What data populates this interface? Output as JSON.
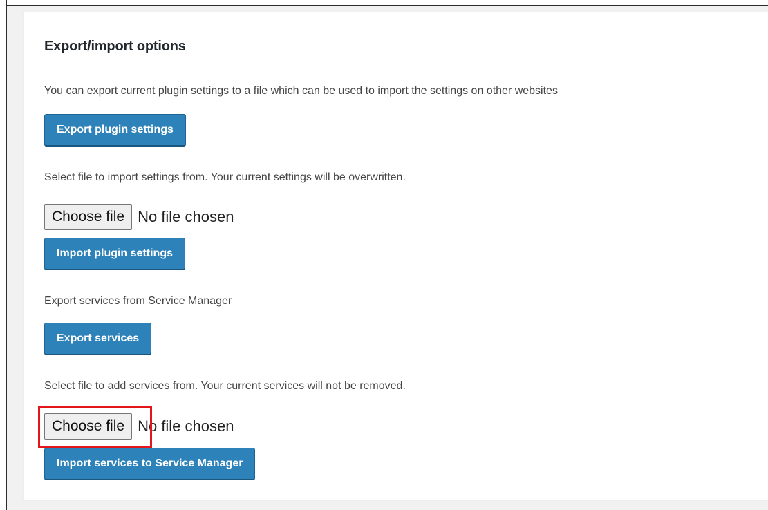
{
  "section": {
    "title": "Export/import options"
  },
  "export_settings": {
    "description": "You can export current plugin settings to a file which can be used to import the settings on other websites",
    "button_label": "Export plugin settings"
  },
  "import_settings": {
    "description": "Select file to import settings from. Your current settings will be overwritten.",
    "choose_file_label": "Choose file",
    "file_status": "No file chosen",
    "button_label": "Import plugin settings"
  },
  "export_services": {
    "description": "Export services from Service Manager",
    "button_label": "Export services"
  },
  "import_services": {
    "description": "Select file to add services from. Your current services will not be removed.",
    "choose_file_label": "Choose file",
    "file_status": "No file chosen",
    "button_label": "Import services to Service Manager"
  },
  "colors": {
    "primary_button": "#2e82ba",
    "highlight": "#e3161b"
  }
}
